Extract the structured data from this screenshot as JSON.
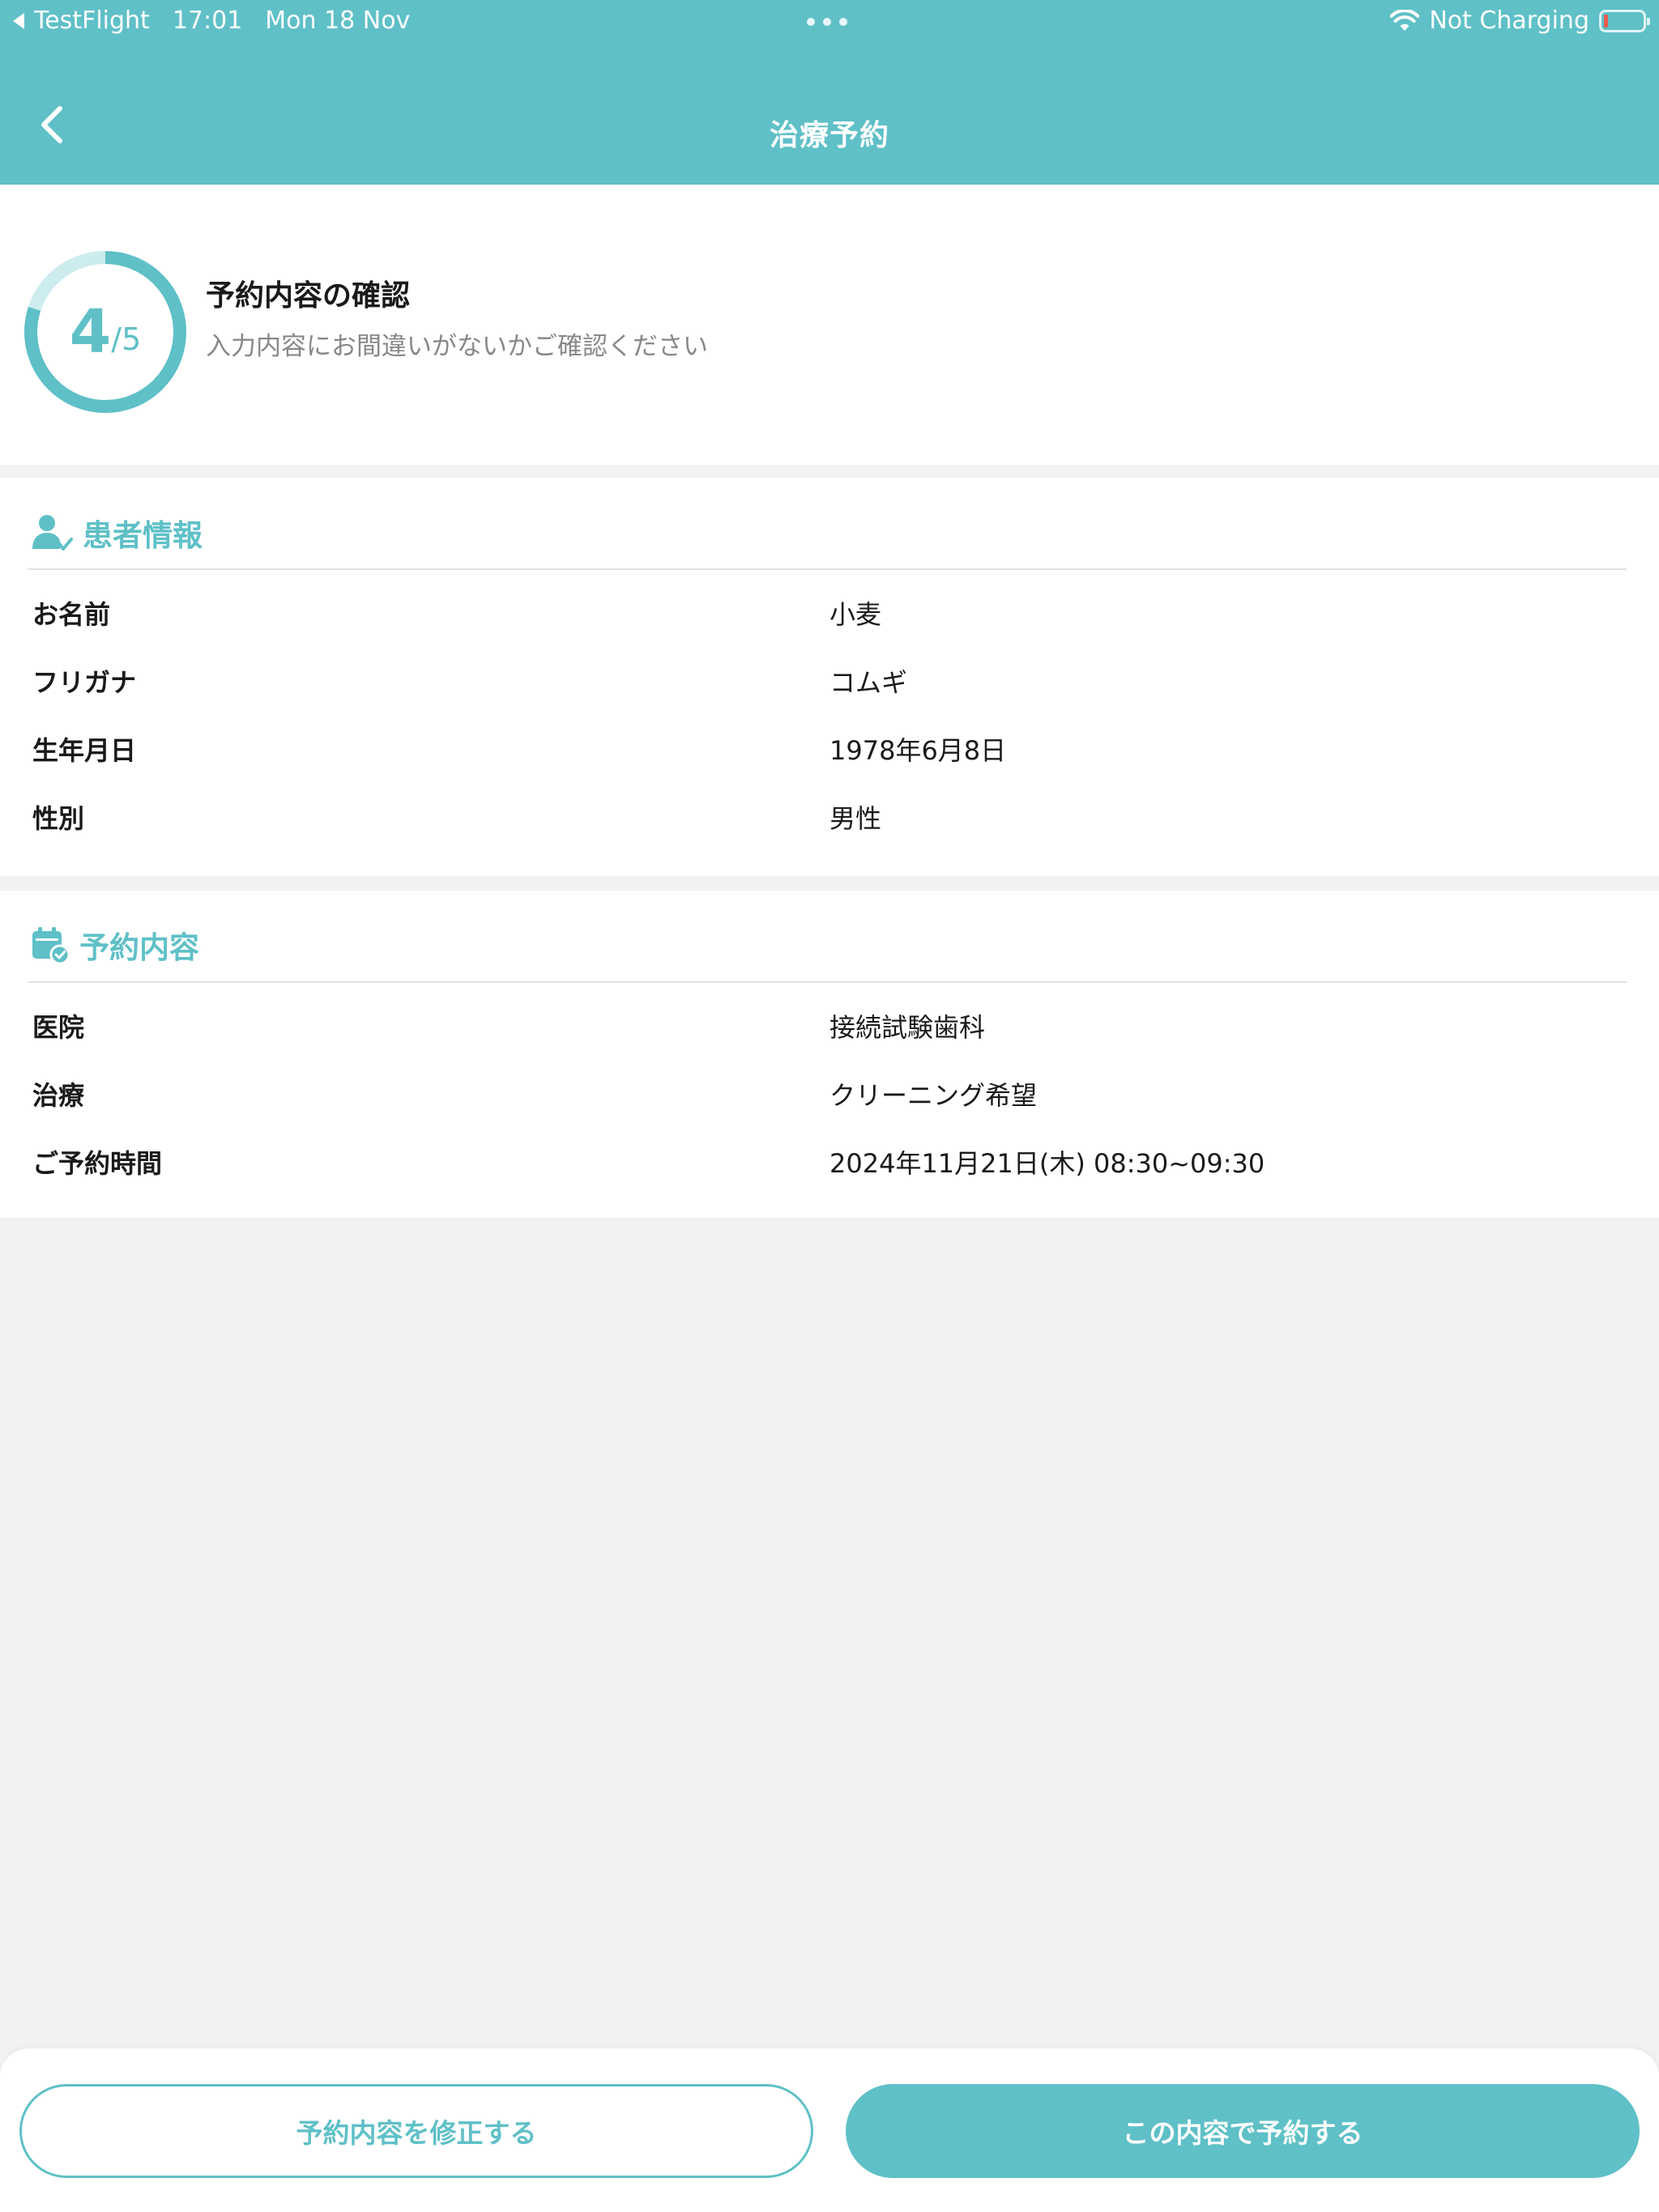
{
  "status_bar": {
    "back_app": "TestFlight",
    "time": "17:01",
    "date": "Mon 18 Nov",
    "charging": "Not Charging"
  },
  "nav": {
    "title": "治療予約"
  },
  "progress": {
    "current": "4",
    "slash": "/",
    "total": "5",
    "fraction": 0.8,
    "title": "予約内容の確認",
    "description": "入力内容にお間違いがないかご確認ください"
  },
  "patient": {
    "header": "患者情報",
    "rows": [
      {
        "label": "お名前",
        "value": "小麦"
      },
      {
        "label": "フリガナ",
        "value": "コムギ"
      },
      {
        "label": "生年月日",
        "value": "1978年6月8日"
      },
      {
        "label": "性別",
        "value": "男性"
      }
    ]
  },
  "reservation": {
    "header": "予約内容",
    "rows": [
      {
        "label": "医院",
        "value": "接続試験歯科"
      },
      {
        "label": "治療",
        "value": "クリーニング希望"
      },
      {
        "label": "ご予約時間",
        "value": "2024年11月21日(木) 08:30~09:30"
      }
    ]
  },
  "footer": {
    "edit_label": "予約内容を修正する",
    "confirm_label": "この内容で予約する"
  },
  "colors": {
    "accent": "#5fc0c7",
    "accent_light": "#cdecee"
  }
}
